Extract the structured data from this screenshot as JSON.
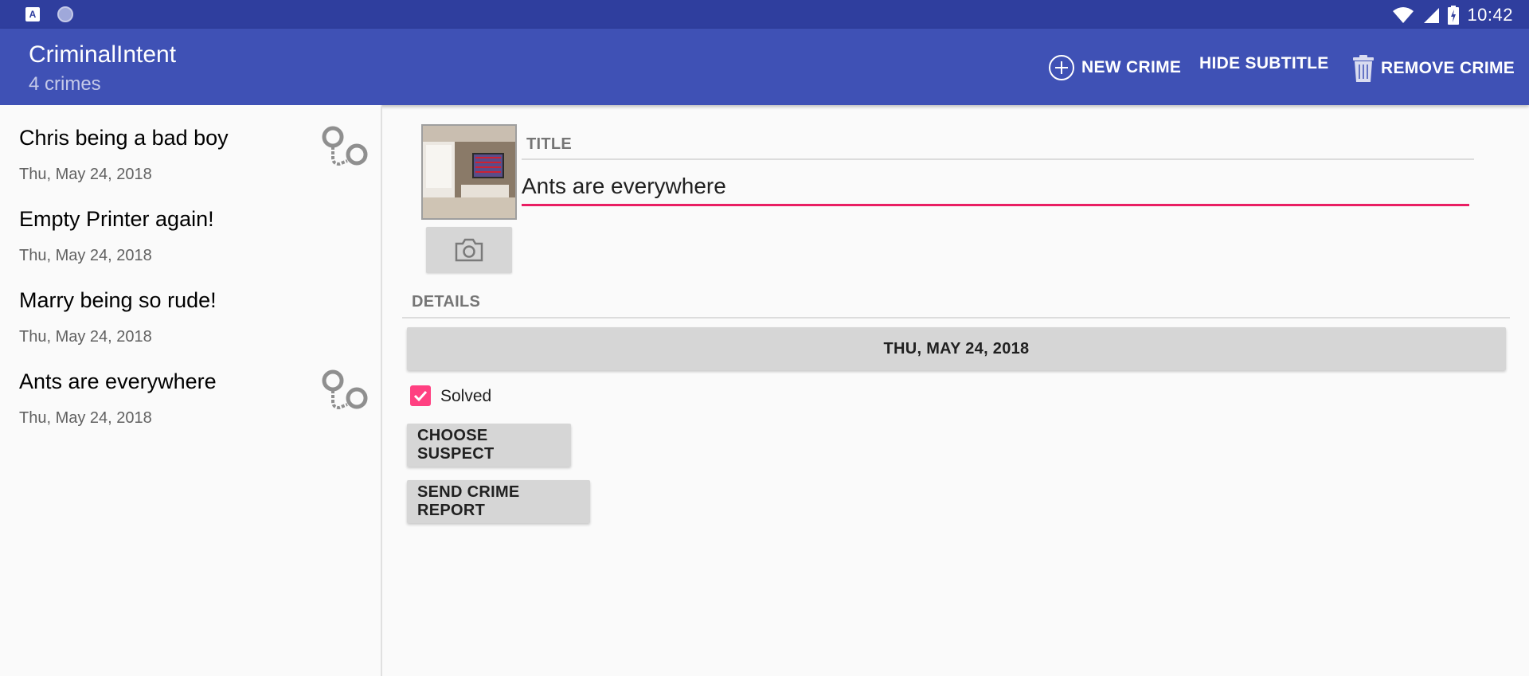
{
  "status_bar": {
    "time": "10:42",
    "left_icons": [
      "keyboard-a-icon",
      "sync-circle-icon"
    ],
    "right_icons": [
      "wifi-icon",
      "signal-icon",
      "battery-charging-icon"
    ]
  },
  "app_bar": {
    "title": "CriminalIntent",
    "subtitle": "4 crimes",
    "actions": {
      "new_crime": "NEW CRIME",
      "hide_subtitle": "HIDE SUBTITLE",
      "remove_crime": "REMOVE CRIME"
    }
  },
  "crime_list": [
    {
      "title": "Chris being a bad boy",
      "date": "Thu, May 24, 2018",
      "solved": true
    },
    {
      "title": "Empty Printer again!",
      "date": "Thu, May 24, 2018",
      "solved": false
    },
    {
      "title": "Marry being so rude!",
      "date": "Thu, May 24, 2018",
      "solved": false
    },
    {
      "title": "Ants are everywhere",
      "date": "Thu, May 24, 2018",
      "solved": true
    }
  ],
  "detail": {
    "title_label": "TITLE",
    "title_value": "Ants are everywhere",
    "details_label": "DETAILS",
    "date_button": "THU, MAY 24, 2018",
    "solved_label": "Solved",
    "solved_checked": true,
    "choose_suspect": "CHOOSE SUSPECT",
    "send_report": "SEND CRIME REPORT"
  },
  "colors": {
    "status_bar": "#2f3e9e",
    "primary": "#3f51b5",
    "accent": "#ff4081",
    "input_underline": "#e91e63"
  }
}
